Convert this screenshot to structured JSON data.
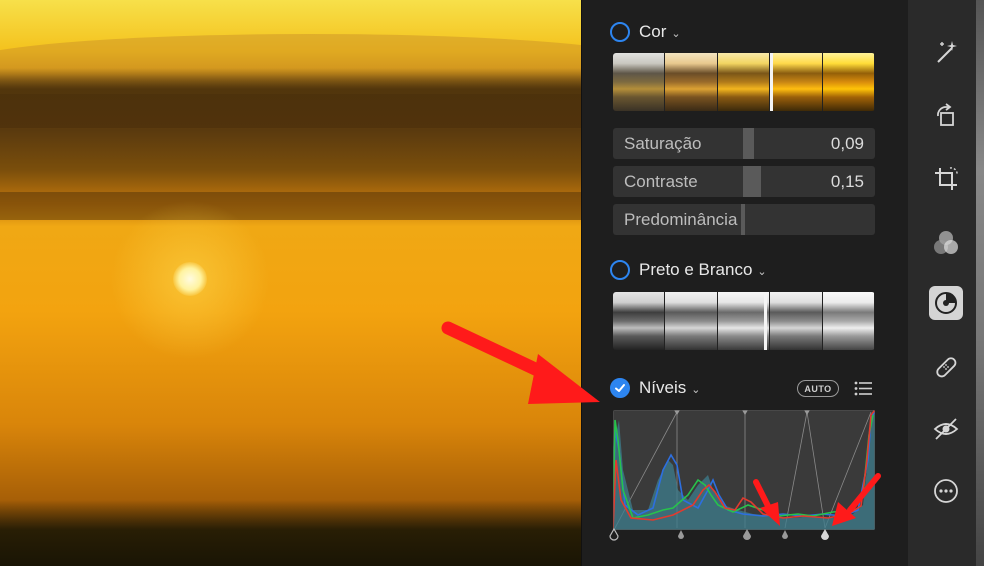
{
  "panel": {
    "cor": {
      "title": "Cor",
      "enabled": false
    },
    "sliders": [
      {
        "label": "Saturação",
        "value": "0,09"
      },
      {
        "label": "Contraste",
        "value": "0,15"
      },
      {
        "label": "Predominância",
        "value": ""
      }
    ],
    "bw": {
      "title": "Preto e Branco",
      "enabled": false
    },
    "levels": {
      "title": "Níveis",
      "enabled": true,
      "auto_label": "AUTO"
    }
  },
  "toolbar": {
    "icons": [
      "magic-wand-icon",
      "rotate-icon",
      "crop-icon",
      "filters-icon",
      "adjust-icon",
      "retouch-bandage-icon",
      "red-eye-icon",
      "more-icon"
    ],
    "active": "adjust-icon"
  },
  "colors": {
    "accent": "#2d85f0",
    "annotation": "#ff1a1a"
  }
}
